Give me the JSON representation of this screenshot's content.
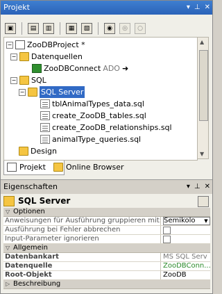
{
  "project_panel": {
    "title": "Projekt",
    "title_buttons": [
      "▾",
      "⊥",
      "✕"
    ],
    "tree": {
      "root": "ZooDBProject *",
      "datenquellen": "Datenquellen",
      "connection": "ZooDBConnect",
      "connection_suffix": "ADO",
      "connection_arrow": "➜",
      "sql": "SQL",
      "sql_server": "SQL Server",
      "files": [
        "tblAnimalTypes_data.sql",
        "create_ZooDB_tables.sql",
        "create_ZooDB_relationships.sql",
        "animalType_queries.sql"
      ],
      "design": "Design"
    },
    "tabs": [
      "Projekt",
      "Online Browser"
    ]
  },
  "properties_panel": {
    "title": "Eigenschaften",
    "title_buttons": [
      "▾",
      "⊥",
      "✕"
    ],
    "object_title": "SQL Server",
    "sections": {
      "optionen": "Optionen",
      "allgemein": "Allgemein",
      "beschreibung": "Beschreibung"
    },
    "optionen_rows": [
      {
        "key": "Anweisungen für Ausführung gruppieren mit:",
        "value": "Semikolo"
      },
      {
        "key": "Ausführung bei Fehler abbrechen",
        "value": ""
      },
      {
        "key": "Input-Parameter ignorieren",
        "value": ""
      }
    ],
    "allgemein_rows": [
      {
        "key": "Datenbankart",
        "value": "MS SQL Serv"
      },
      {
        "key": "Datenquelle",
        "value": "ZooDBConn..."
      },
      {
        "key": "Root-Objekt",
        "value": "ZooDB"
      }
    ]
  }
}
